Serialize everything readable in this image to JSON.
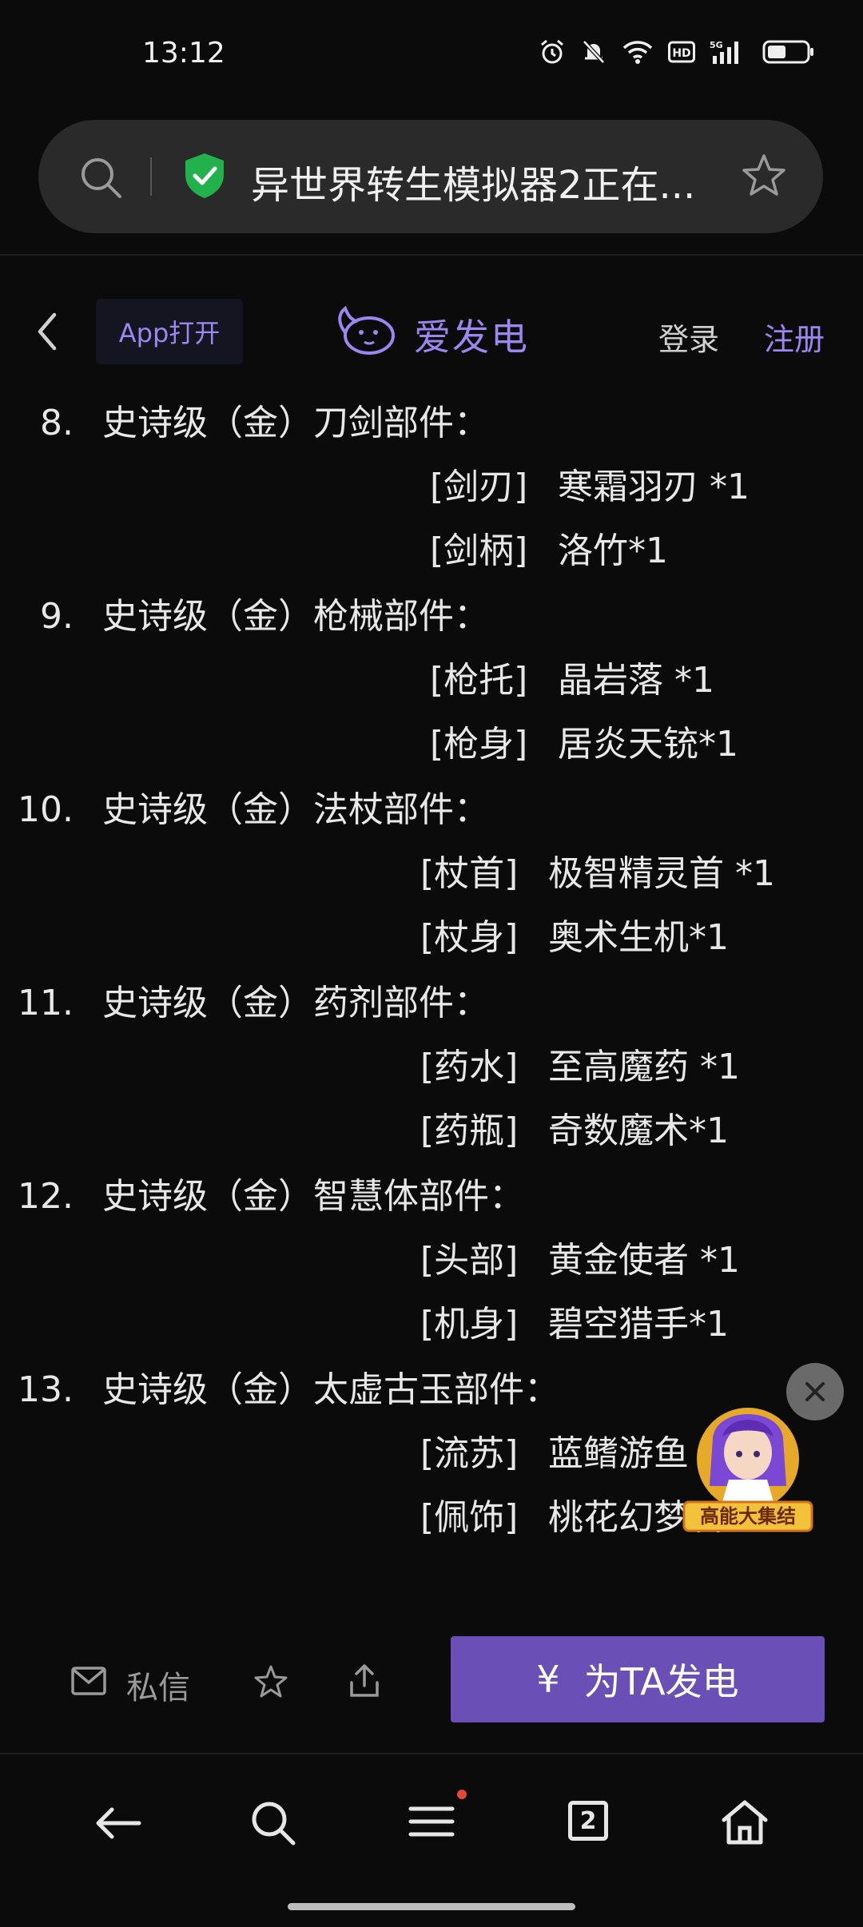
{
  "status": {
    "time": "13:12"
  },
  "urlbar": {
    "title": "异世界转生模拟器2正在..."
  },
  "sitenav": {
    "app_open": "App打开",
    "logo_text": "爱发电",
    "login": "登录",
    "register": "注册"
  },
  "items": [
    {
      "num": "8.",
      "title": "史诗级（金）刀剑部件：",
      "parts": [
        {
          "tag": "[剑刃]",
          "name": "寒霜羽刃 *1"
        },
        {
          "tag": "[剑柄]",
          "name": "洛竹*1"
        }
      ]
    },
    {
      "num": "9.",
      "title": "史诗级（金）枪械部件：",
      "parts": [
        {
          "tag": "[枪托]",
          "name": "晶岩落 *1"
        },
        {
          "tag": "[枪身]",
          "name": "居炎天铳*1"
        }
      ]
    },
    {
      "num": "10.",
      "title": "史诗级（金）法杖部件：",
      "parts": [
        {
          "tag": "[杖首]",
          "name": "极智精灵首 *1"
        },
        {
          "tag": "[杖身]",
          "name": "奥术生机*1"
        }
      ]
    },
    {
      "num": "11.",
      "title": "史诗级（金）药剂部件：",
      "parts": [
        {
          "tag": "[药水]",
          "name": "至高魔药 *1"
        },
        {
          "tag": "[药瓶]",
          "name": "奇数魔术*1"
        }
      ]
    },
    {
      "num": "12.",
      "title": "史诗级（金）智慧体部件：",
      "parts": [
        {
          "tag": "[头部]",
          "name": "黄金使者 *1"
        },
        {
          "tag": "[机身]",
          "name": "碧空猎手*1"
        }
      ]
    },
    {
      "num": "13.",
      "title": "史诗级（金）太虚古玉部件：",
      "parts": [
        {
          "tag": "[流苏]",
          "name": "蓝鳍游鱼"
        },
        {
          "tag": "[佩饰]",
          "name": "桃花幻梦石*1"
        }
      ]
    }
  ],
  "promo": {
    "label": "高能大集结"
  },
  "actionbar": {
    "pm_label": "私信",
    "charge_label": "为TA发电",
    "charge_symbol": "¥"
  },
  "bottomnav": {
    "tab_count": "2"
  },
  "colors": {
    "accent": "#9c87f0",
    "button": "#6a4fb6",
    "background": "#0b0b0b"
  }
}
